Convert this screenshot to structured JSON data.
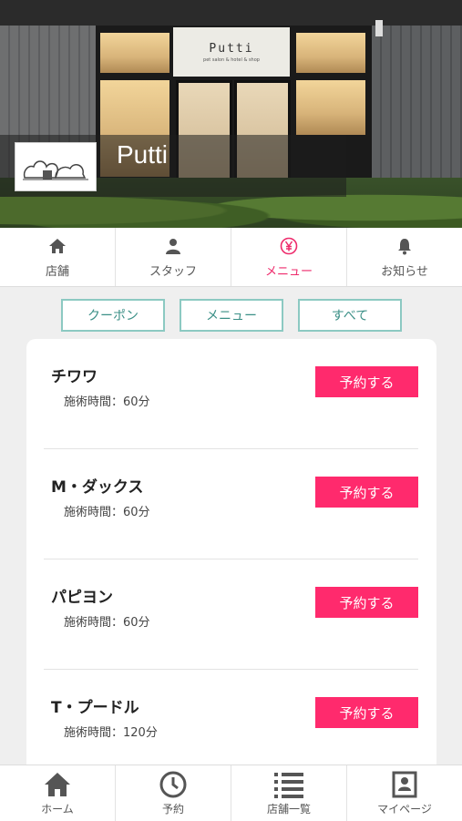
{
  "shop": {
    "name": "Putti",
    "sign_text": "Putti",
    "sign_sub": "pet salon & hotel & shop"
  },
  "tabs": [
    {
      "label": "店舗",
      "icon": "home-icon",
      "active": false
    },
    {
      "label": "スタッフ",
      "icon": "person-icon",
      "active": false
    },
    {
      "label": "メニュー",
      "icon": "yen-icon",
      "active": true
    },
    {
      "label": "お知らせ",
      "icon": "bell-icon",
      "active": false
    }
  ],
  "filters": [
    {
      "label": "クーポン"
    },
    {
      "label": "メニュー"
    },
    {
      "label": "すべて"
    }
  ],
  "menu_items": [
    {
      "name": "チワワ",
      "time": "施術時間：60分",
      "button": "予約する"
    },
    {
      "name": "M・ダックス",
      "time": "施術時間：60分",
      "button": "予約する"
    },
    {
      "name": "パピヨン",
      "time": "施術時間：60分",
      "button": "予約する"
    },
    {
      "name": "T・プードル",
      "time": "施術時間：120分",
      "button": "予約する"
    }
  ],
  "bottom_nav": [
    {
      "label": "ホーム",
      "icon": "home-icon"
    },
    {
      "label": "予約",
      "icon": "clock-icon"
    },
    {
      "label": "店舗一覧",
      "icon": "list-icon"
    },
    {
      "label": "マイページ",
      "icon": "profile-card-icon"
    }
  ],
  "colors": {
    "accent": "#ff2a6d",
    "active_tab": "#ee2b6c",
    "filter_border": "#8cc9c2",
    "filter_text": "#3a8f86",
    "background": "#efefef"
  }
}
